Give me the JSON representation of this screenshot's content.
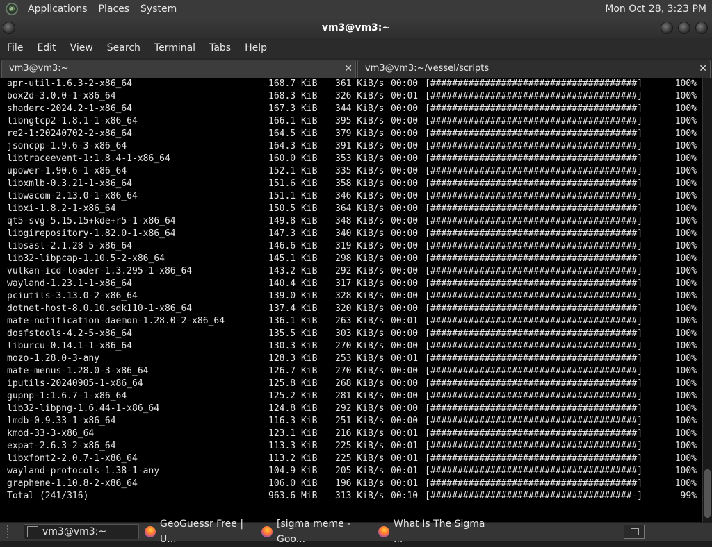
{
  "top_panel": {
    "menus": [
      "Applications",
      "Places",
      "System"
    ],
    "clock": "Mon Oct 28,  3:23 PM"
  },
  "window": {
    "title": "vm3@vm3:~"
  },
  "menubar": [
    "File",
    "Edit",
    "View",
    "Search",
    "Terminal",
    "Tabs",
    "Help"
  ],
  "tabs": [
    {
      "label": "vm3@vm3:~",
      "close": "✕"
    },
    {
      "label": "vm3@vm3:~/vessel/scripts",
      "close": "✕"
    }
  ],
  "terminal": {
    "rows": [
      {
        "name": "apr-util-1.6.3-2-x86_64",
        "size": "168.7 KiB",
        "rate": "361 KiB/s",
        "time": "00:00",
        "bar": "[######################################]",
        "pct": "100%"
      },
      {
        "name": "box2d-3.0.0-1-x86_64",
        "size": "168.3 KiB",
        "rate": "326 KiB/s",
        "time": "00:01",
        "bar": "[######################################]",
        "pct": "100%"
      },
      {
        "name": "shaderc-2024.2-1-x86_64",
        "size": "167.3 KiB",
        "rate": "344 KiB/s",
        "time": "00:00",
        "bar": "[######################################]",
        "pct": "100%"
      },
      {
        "name": "libngtcp2-1.8.1-1-x86_64",
        "size": "166.1 KiB",
        "rate": "395 KiB/s",
        "time": "00:00",
        "bar": "[######################################]",
        "pct": "100%"
      },
      {
        "name": "re2-1:20240702-2-x86_64",
        "size": "164.5 KiB",
        "rate": "379 KiB/s",
        "time": "00:00",
        "bar": "[######################################]",
        "pct": "100%"
      },
      {
        "name": "jsoncpp-1.9.6-3-x86_64",
        "size": "164.3 KiB",
        "rate": "391 KiB/s",
        "time": "00:00",
        "bar": "[######################################]",
        "pct": "100%"
      },
      {
        "name": "libtraceevent-1:1.8.4-1-x86_64",
        "size": "160.0 KiB",
        "rate": "353 KiB/s",
        "time": "00:00",
        "bar": "[######################################]",
        "pct": "100%"
      },
      {
        "name": "upower-1.90.6-1-x86_64",
        "size": "152.1 KiB",
        "rate": "335 KiB/s",
        "time": "00:00",
        "bar": "[######################################]",
        "pct": "100%"
      },
      {
        "name": "libxmlb-0.3.21-1-x86_64",
        "size": "151.6 KiB",
        "rate": "358 KiB/s",
        "time": "00:00",
        "bar": "[######################################]",
        "pct": "100%"
      },
      {
        "name": "libwacom-2.13.0-1-x86_64",
        "size": "151.1 KiB",
        "rate": "346 KiB/s",
        "time": "00:00",
        "bar": "[######################################]",
        "pct": "100%"
      },
      {
        "name": "libxi-1.8.2-1-x86_64",
        "size": "150.5 KiB",
        "rate": "364 KiB/s",
        "time": "00:00",
        "bar": "[######################################]",
        "pct": "100%"
      },
      {
        "name": "qt5-svg-5.15.15+kde+r5-1-x86_64",
        "size": "149.8 KiB",
        "rate": "348 KiB/s",
        "time": "00:00",
        "bar": "[######################################]",
        "pct": "100%"
      },
      {
        "name": "libgirepository-1.82.0-1-x86_64",
        "size": "147.3 KiB",
        "rate": "340 KiB/s",
        "time": "00:00",
        "bar": "[######################################]",
        "pct": "100%"
      },
      {
        "name": "libsasl-2.1.28-5-x86_64",
        "size": "146.6 KiB",
        "rate": "319 KiB/s",
        "time": "00:00",
        "bar": "[######################################]",
        "pct": "100%"
      },
      {
        "name": "lib32-libpcap-1.10.5-2-x86_64",
        "size": "145.1 KiB",
        "rate": "298 KiB/s",
        "time": "00:00",
        "bar": "[######################################]",
        "pct": "100%"
      },
      {
        "name": "vulkan-icd-loader-1.3.295-1-x86_64",
        "size": "143.2 KiB",
        "rate": "292 KiB/s",
        "time": "00:00",
        "bar": "[######################################]",
        "pct": "100%"
      },
      {
        "name": "wayland-1.23.1-1-x86_64",
        "size": "140.4 KiB",
        "rate": "317 KiB/s",
        "time": "00:00",
        "bar": "[######################################]",
        "pct": "100%"
      },
      {
        "name": "pciutils-3.13.0-2-x86_64",
        "size": "139.0 KiB",
        "rate": "328 KiB/s",
        "time": "00:00",
        "bar": "[######################################]",
        "pct": "100%"
      },
      {
        "name": "dotnet-host-8.0.10.sdk110-1-x86_64",
        "size": "137.4 KiB",
        "rate": "320 KiB/s",
        "time": "00:00",
        "bar": "[######################################]",
        "pct": "100%"
      },
      {
        "name": "mate-notification-daemon-1.28.0-2-x86_64",
        "size": "136.1 KiB",
        "rate": "263 KiB/s",
        "time": "00:01",
        "bar": "[######################################]",
        "pct": "100%"
      },
      {
        "name": "dosfstools-4.2-5-x86_64",
        "size": "135.5 KiB",
        "rate": "303 KiB/s",
        "time": "00:00",
        "bar": "[######################################]",
        "pct": "100%"
      },
      {
        "name": "liburcu-0.14.1-1-x86_64",
        "size": "130.3 KiB",
        "rate": "270 KiB/s",
        "time": "00:00",
        "bar": "[######################################]",
        "pct": "100%"
      },
      {
        "name": "mozo-1.28.0-3-any",
        "size": "128.3 KiB",
        "rate": "253 KiB/s",
        "time": "00:01",
        "bar": "[######################################]",
        "pct": "100%"
      },
      {
        "name": "mate-menus-1.28.0-3-x86_64",
        "size": "126.7 KiB",
        "rate": "270 KiB/s",
        "time": "00:00",
        "bar": "[######################################]",
        "pct": "100%"
      },
      {
        "name": "iputils-20240905-1-x86_64",
        "size": "125.8 KiB",
        "rate": "268 KiB/s",
        "time": "00:00",
        "bar": "[######################################]",
        "pct": "100%"
      },
      {
        "name": "gupnp-1:1.6.7-1-x86_64",
        "size": "125.2 KiB",
        "rate": "281 KiB/s",
        "time": "00:00",
        "bar": "[######################################]",
        "pct": "100%"
      },
      {
        "name": "lib32-libpng-1.6.44-1-x86_64",
        "size": "124.8 KiB",
        "rate": "292 KiB/s",
        "time": "00:00",
        "bar": "[######################################]",
        "pct": "100%"
      },
      {
        "name": "lmdb-0.9.33-1-x86_64",
        "size": "116.3 KiB",
        "rate": "251 KiB/s",
        "time": "00:00",
        "bar": "[######################################]",
        "pct": "100%"
      },
      {
        "name": "kmod-33-3-x86_64",
        "size": "123.1 KiB",
        "rate": "216 KiB/s",
        "time": "00:01",
        "bar": "[######################################]",
        "pct": "100%"
      },
      {
        "name": "expat-2.6.3-2-x86_64",
        "size": "113.3 KiB",
        "rate": "225 KiB/s",
        "time": "00:01",
        "bar": "[######################################]",
        "pct": "100%"
      },
      {
        "name": "libxfont2-2.0.7-1-x86_64",
        "size": "113.2 KiB",
        "rate": "225 KiB/s",
        "time": "00:01",
        "bar": "[######################################]",
        "pct": "100%"
      },
      {
        "name": "wayland-protocols-1.38-1-any",
        "size": "104.9 KiB",
        "rate": "205 KiB/s",
        "time": "00:01",
        "bar": "[######################################]",
        "pct": "100%"
      },
      {
        "name": "graphene-1.10.8-2-x86_64",
        "size": "106.0 KiB",
        "rate": "196 KiB/s",
        "time": "00:01",
        "bar": "[######################################]",
        "pct": "100%"
      },
      {
        "name": "Total (241/316)",
        "size": "963.6 MiB",
        "rate": "313 KiB/s",
        "time": "00:10",
        "bar": "[#####################################-]",
        "pct": "99%"
      }
    ]
  },
  "taskbar": {
    "items": [
      {
        "label": "vm3@vm3:~",
        "icon": "terminal-icon"
      },
      {
        "label": "GeoGuessr Free | U...",
        "icon": "firefox-icon"
      },
      {
        "label": "[sigma meme - Goo...",
        "icon": "firefox-icon"
      },
      {
        "label": "What Is The Sigma ...",
        "icon": "firefox-icon"
      }
    ]
  },
  "colors": {
    "terminal_bg": "#000000",
    "terminal_fg": "#e6e6e6",
    "panel_bg": "#3a3a3a"
  }
}
